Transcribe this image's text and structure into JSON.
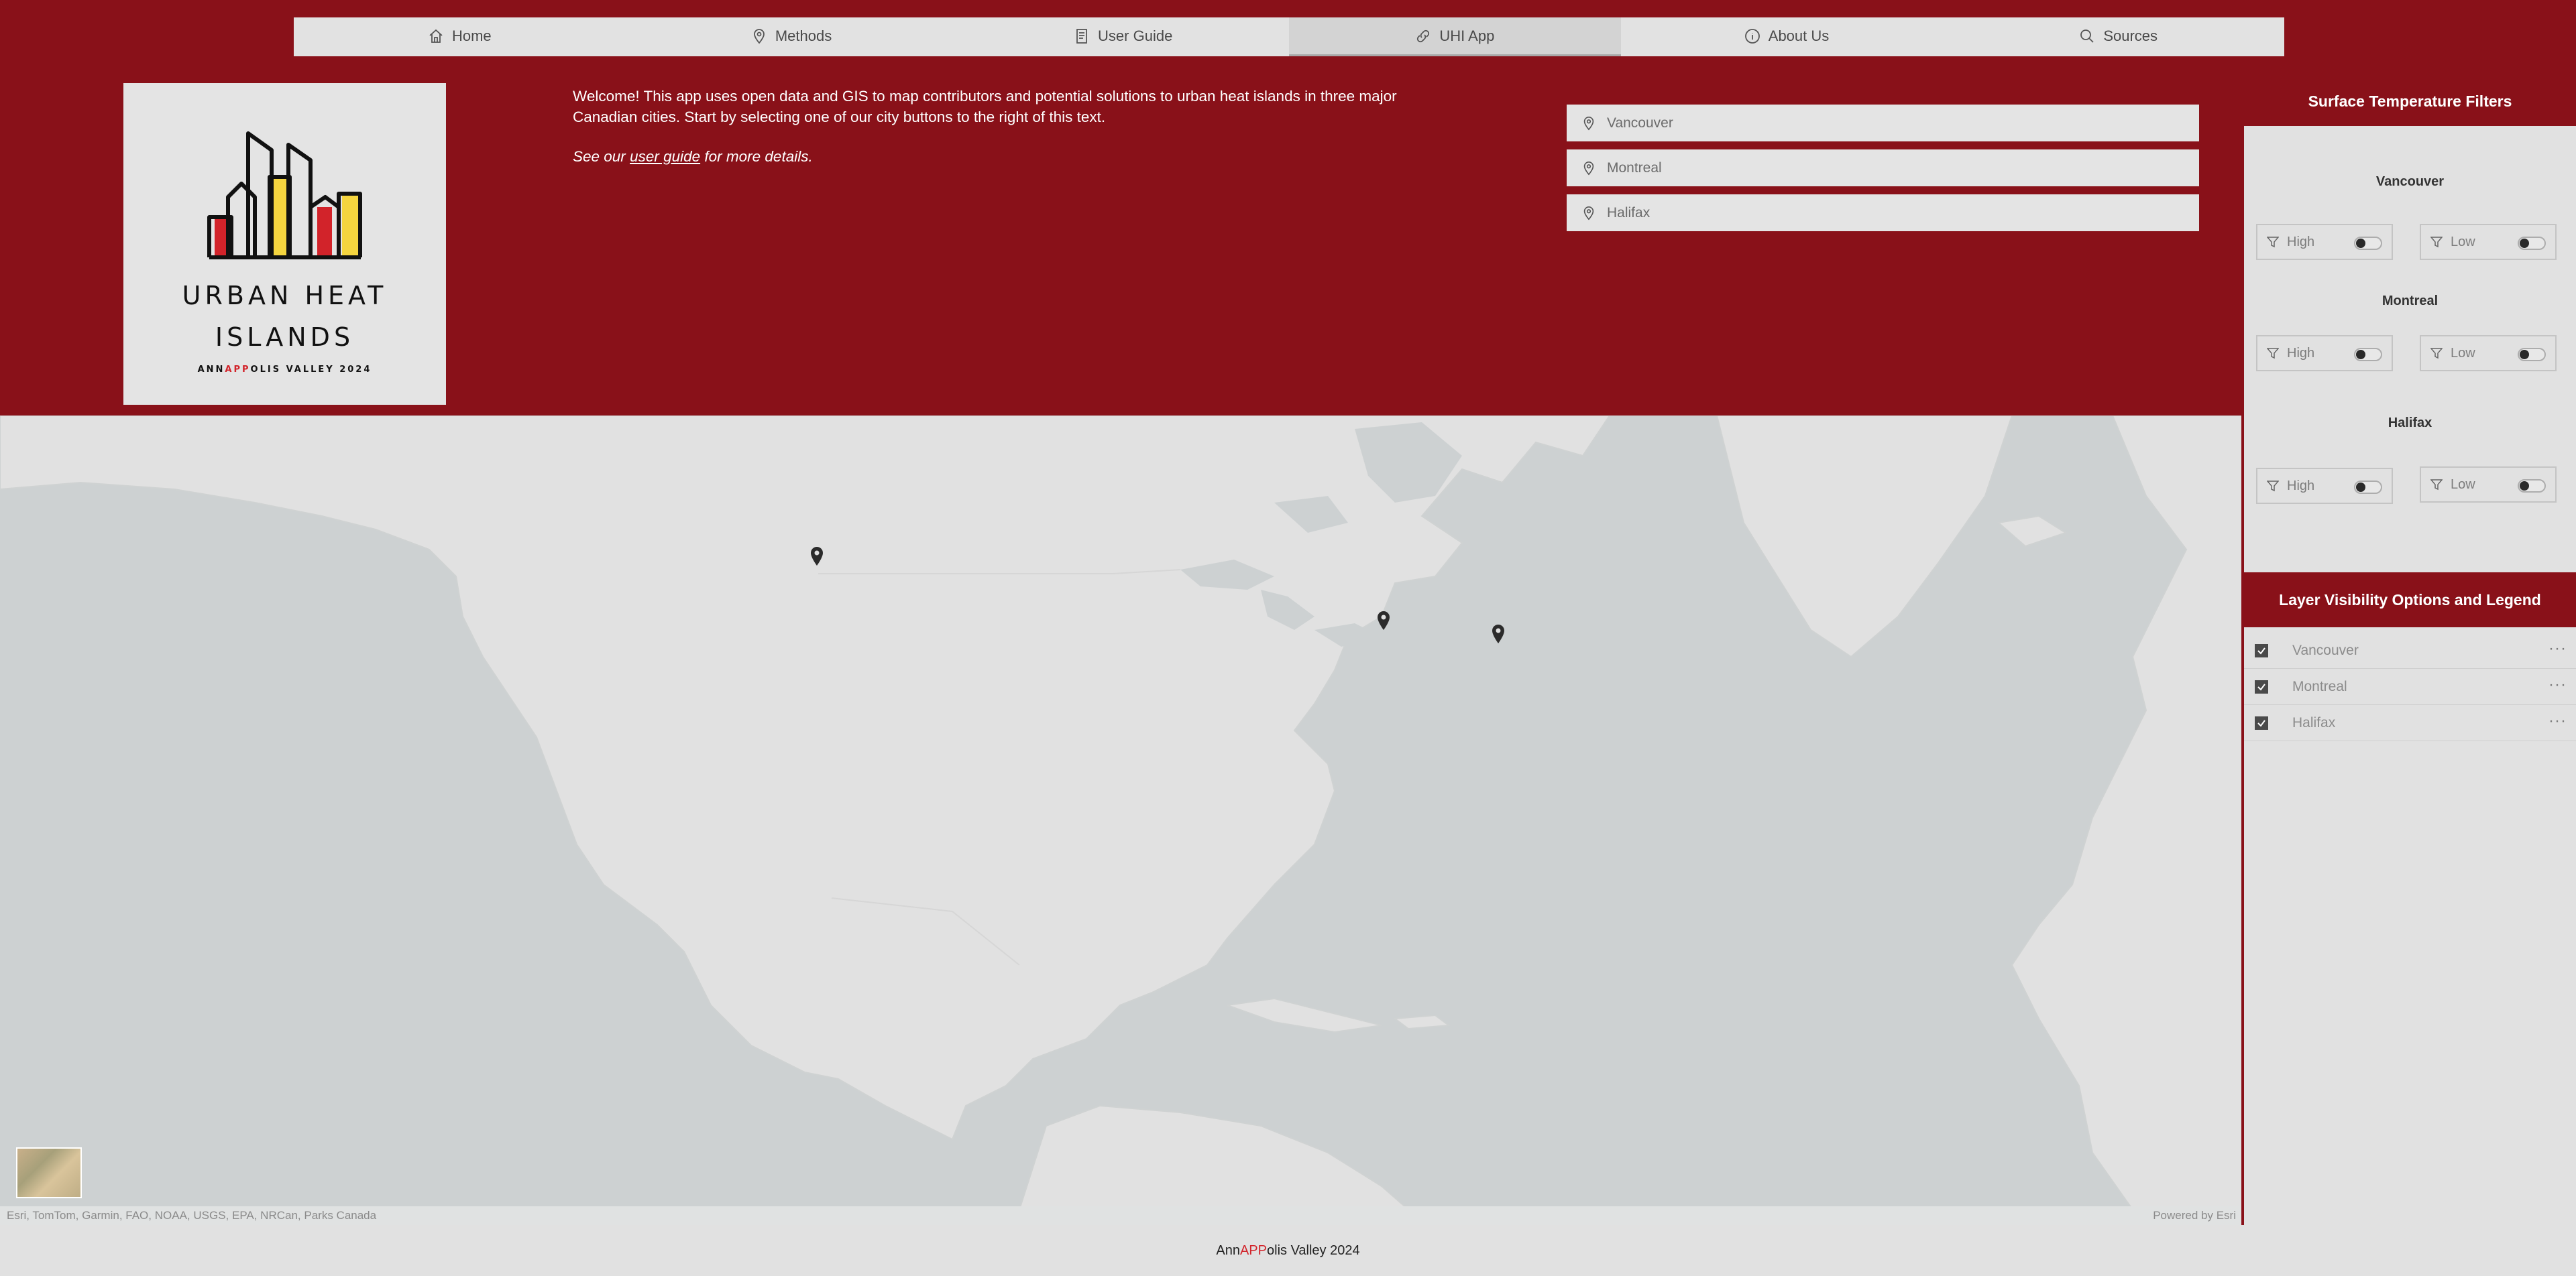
{
  "nav": {
    "items": [
      {
        "label": "Home",
        "icon": "home-icon"
      },
      {
        "label": "Methods",
        "icon": "map-pin-icon"
      },
      {
        "label": "User Guide",
        "icon": "document-icon"
      },
      {
        "label": "UHI App",
        "icon": "link-icon",
        "active": true
      },
      {
        "label": "About Us",
        "icon": "info-icon"
      },
      {
        "label": "Sources",
        "icon": "search-icon"
      }
    ]
  },
  "logo": {
    "title_line1": "URBAN HEAT",
    "title_line2": "ISLANDS",
    "sub_pre": "ANN",
    "sub_app": "APP",
    "sub_post": "OLIS VALLEY 2024"
  },
  "welcome": {
    "text": "Welcome! This app uses open data and GIS to map contributors and potential solutions to urban heat islands in three major Canadian cities. Start by selecting one of our city buttons to the right of this text.",
    "guide_pre": "See our ",
    "guide_link": "user guide",
    "guide_post": " for more details."
  },
  "city_buttons": [
    "Vancouver",
    "Montreal",
    "Halifax"
  ],
  "filters": {
    "title": "Surface Temperature Filters",
    "cities": [
      {
        "name": "Vancouver",
        "high": "High",
        "low": "Low"
      },
      {
        "name": "Montreal",
        "high": "High",
        "low": "Low"
      },
      {
        "name": "Halifax",
        "high": "High",
        "low": "Low"
      }
    ]
  },
  "legend": {
    "title": "Layer Visibility Options and Legend",
    "layers": [
      "Vancouver",
      "Montreal",
      "Halifax"
    ],
    "more": "···"
  },
  "map": {
    "attribution": "Esri, TomTom, Garmin, FAO, NOAA, USGS, EPA, NRCan, Parks Canada",
    "powered": "Powered by Esri"
  },
  "footer": {
    "pre": "Ann",
    "app": "APP",
    "post": "olis Valley 2024"
  },
  "colors": {
    "brand": "#891119",
    "accent_red": "#d2232a",
    "logo_yellow": "#f5d53f"
  }
}
